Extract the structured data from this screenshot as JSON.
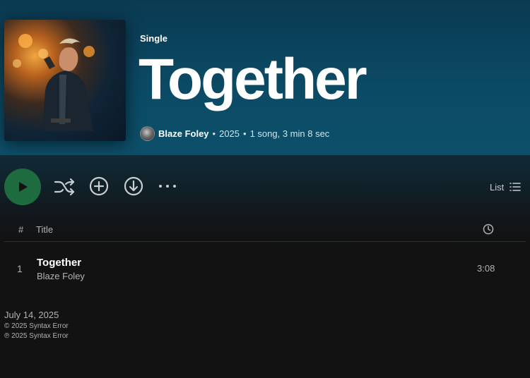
{
  "header": {
    "type_label": "Single",
    "title": "Together",
    "artist": "Blaze Foley",
    "separator": "•",
    "year": "2025",
    "summary": "1 song, 3 min 8 sec"
  },
  "actions": {
    "play": "play-icon",
    "shuffle": "shuffle-icon",
    "add": "add-circle-icon",
    "download": "download-icon",
    "more": "•••",
    "view_label": "List"
  },
  "table": {
    "header_num": "#",
    "header_title": "Title",
    "header_duration_icon": "clock-icon",
    "tracks": [
      {
        "num": "1",
        "title": "Together",
        "artist": "Blaze Foley",
        "duration": "3:08"
      }
    ]
  },
  "footer": {
    "release_date": "July 14, 2025",
    "copyright_c": "© 2025 Syntax Error",
    "copyright_p": "℗ 2025 Syntax Error"
  },
  "colors": {
    "header_bg": "#0b4a64",
    "page_bg": "#121212",
    "play_button": "#1e6b3f"
  }
}
